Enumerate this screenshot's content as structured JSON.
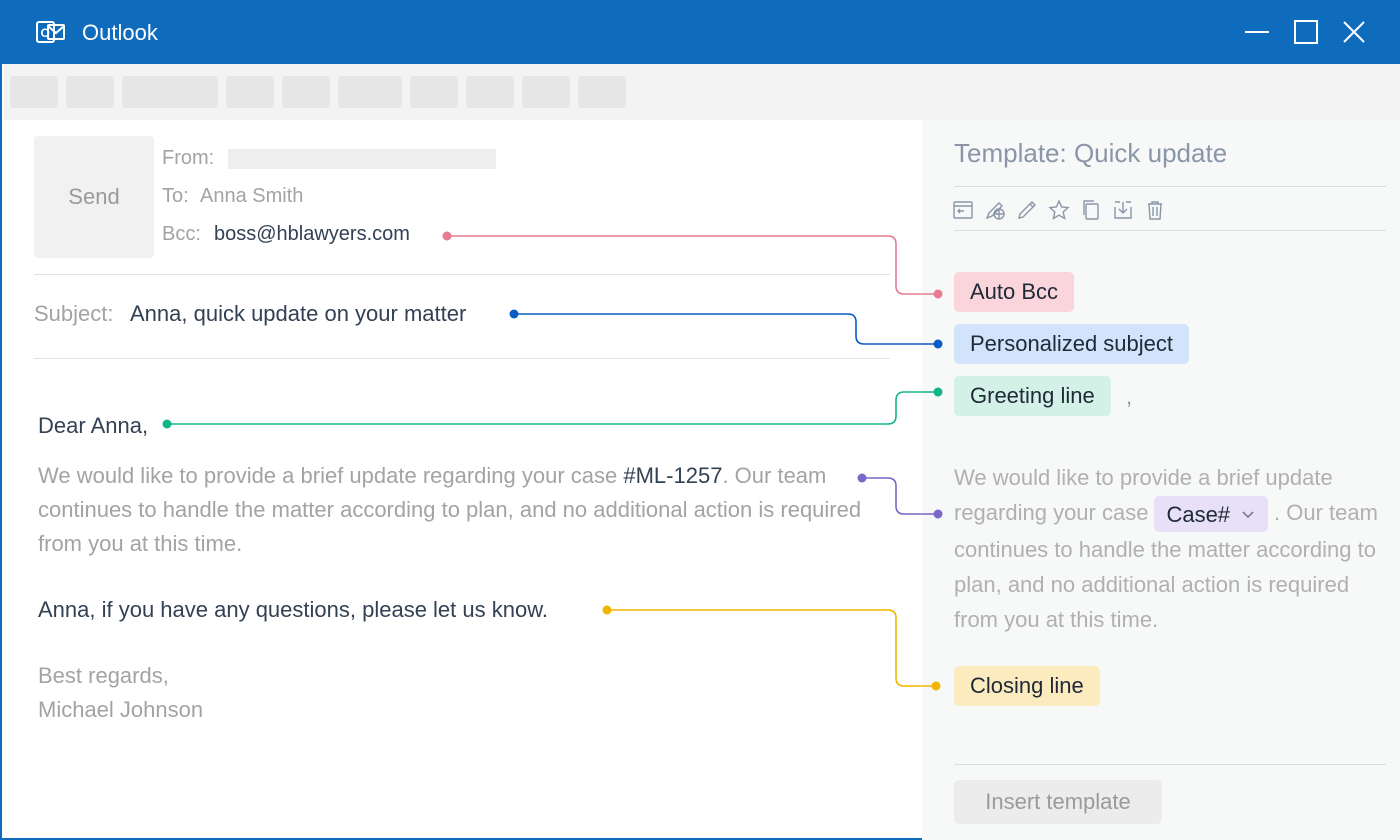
{
  "window": {
    "title": "Outlook",
    "icon": "outlook-icon",
    "controls": [
      "minimize-icon",
      "maximize-icon",
      "close-icon"
    ]
  },
  "toolbar": {
    "button_count": 10
  },
  "compose": {
    "send_label": "Send",
    "from_label": "From:",
    "to_label": "To:",
    "to_value": "Anna Smith",
    "bcc_label": "Bcc:",
    "bcc_value": "boss@hblawyers.com",
    "subject_label": "Subject:",
    "subject_value": "Anna, quick update on your matter",
    "greeting": "Dear Anna,",
    "paragraph_before_case": "We would like to provide a brief update regarding your case ",
    "case_number": "#ML-1257",
    "paragraph_after_case": ". Our team continues to handle the matter according to plan, and no additional action is required from you at this time.",
    "closing": "Anna, if you have any questions, please let us know.",
    "signoff": "Best regards,",
    "signature": "Michael Johnson"
  },
  "template_panel": {
    "title": "Template: Quick update",
    "icons": [
      "insert-icon",
      "web-edit-icon",
      "pencil-icon",
      "star-icon",
      "copy-icon",
      "download-icon",
      "trash-icon"
    ],
    "tags": {
      "auto_bcc": "Auto Bcc",
      "personalized_subject": "Personalized subject",
      "greeting_line": "Greeting line",
      "closing_line": "Closing line"
    },
    "comma": ",",
    "text_before_case": "We would like to provide a brief update regarding your case",
    "case_dropdown": "Case#",
    "text_after_case": ". Our team continues to handle the matter according to plan, and no additional action is required from you at this time.",
    "insert_button": "Insert template"
  },
  "colors": {
    "titlebar": "#0f6cbd",
    "bcc_connector": "#e57c92",
    "subject_connector": "#0a5bc4",
    "greeting_connector": "#14b48a",
    "case_connector": "#7c66c8",
    "closing_connector": "#f2b600"
  }
}
